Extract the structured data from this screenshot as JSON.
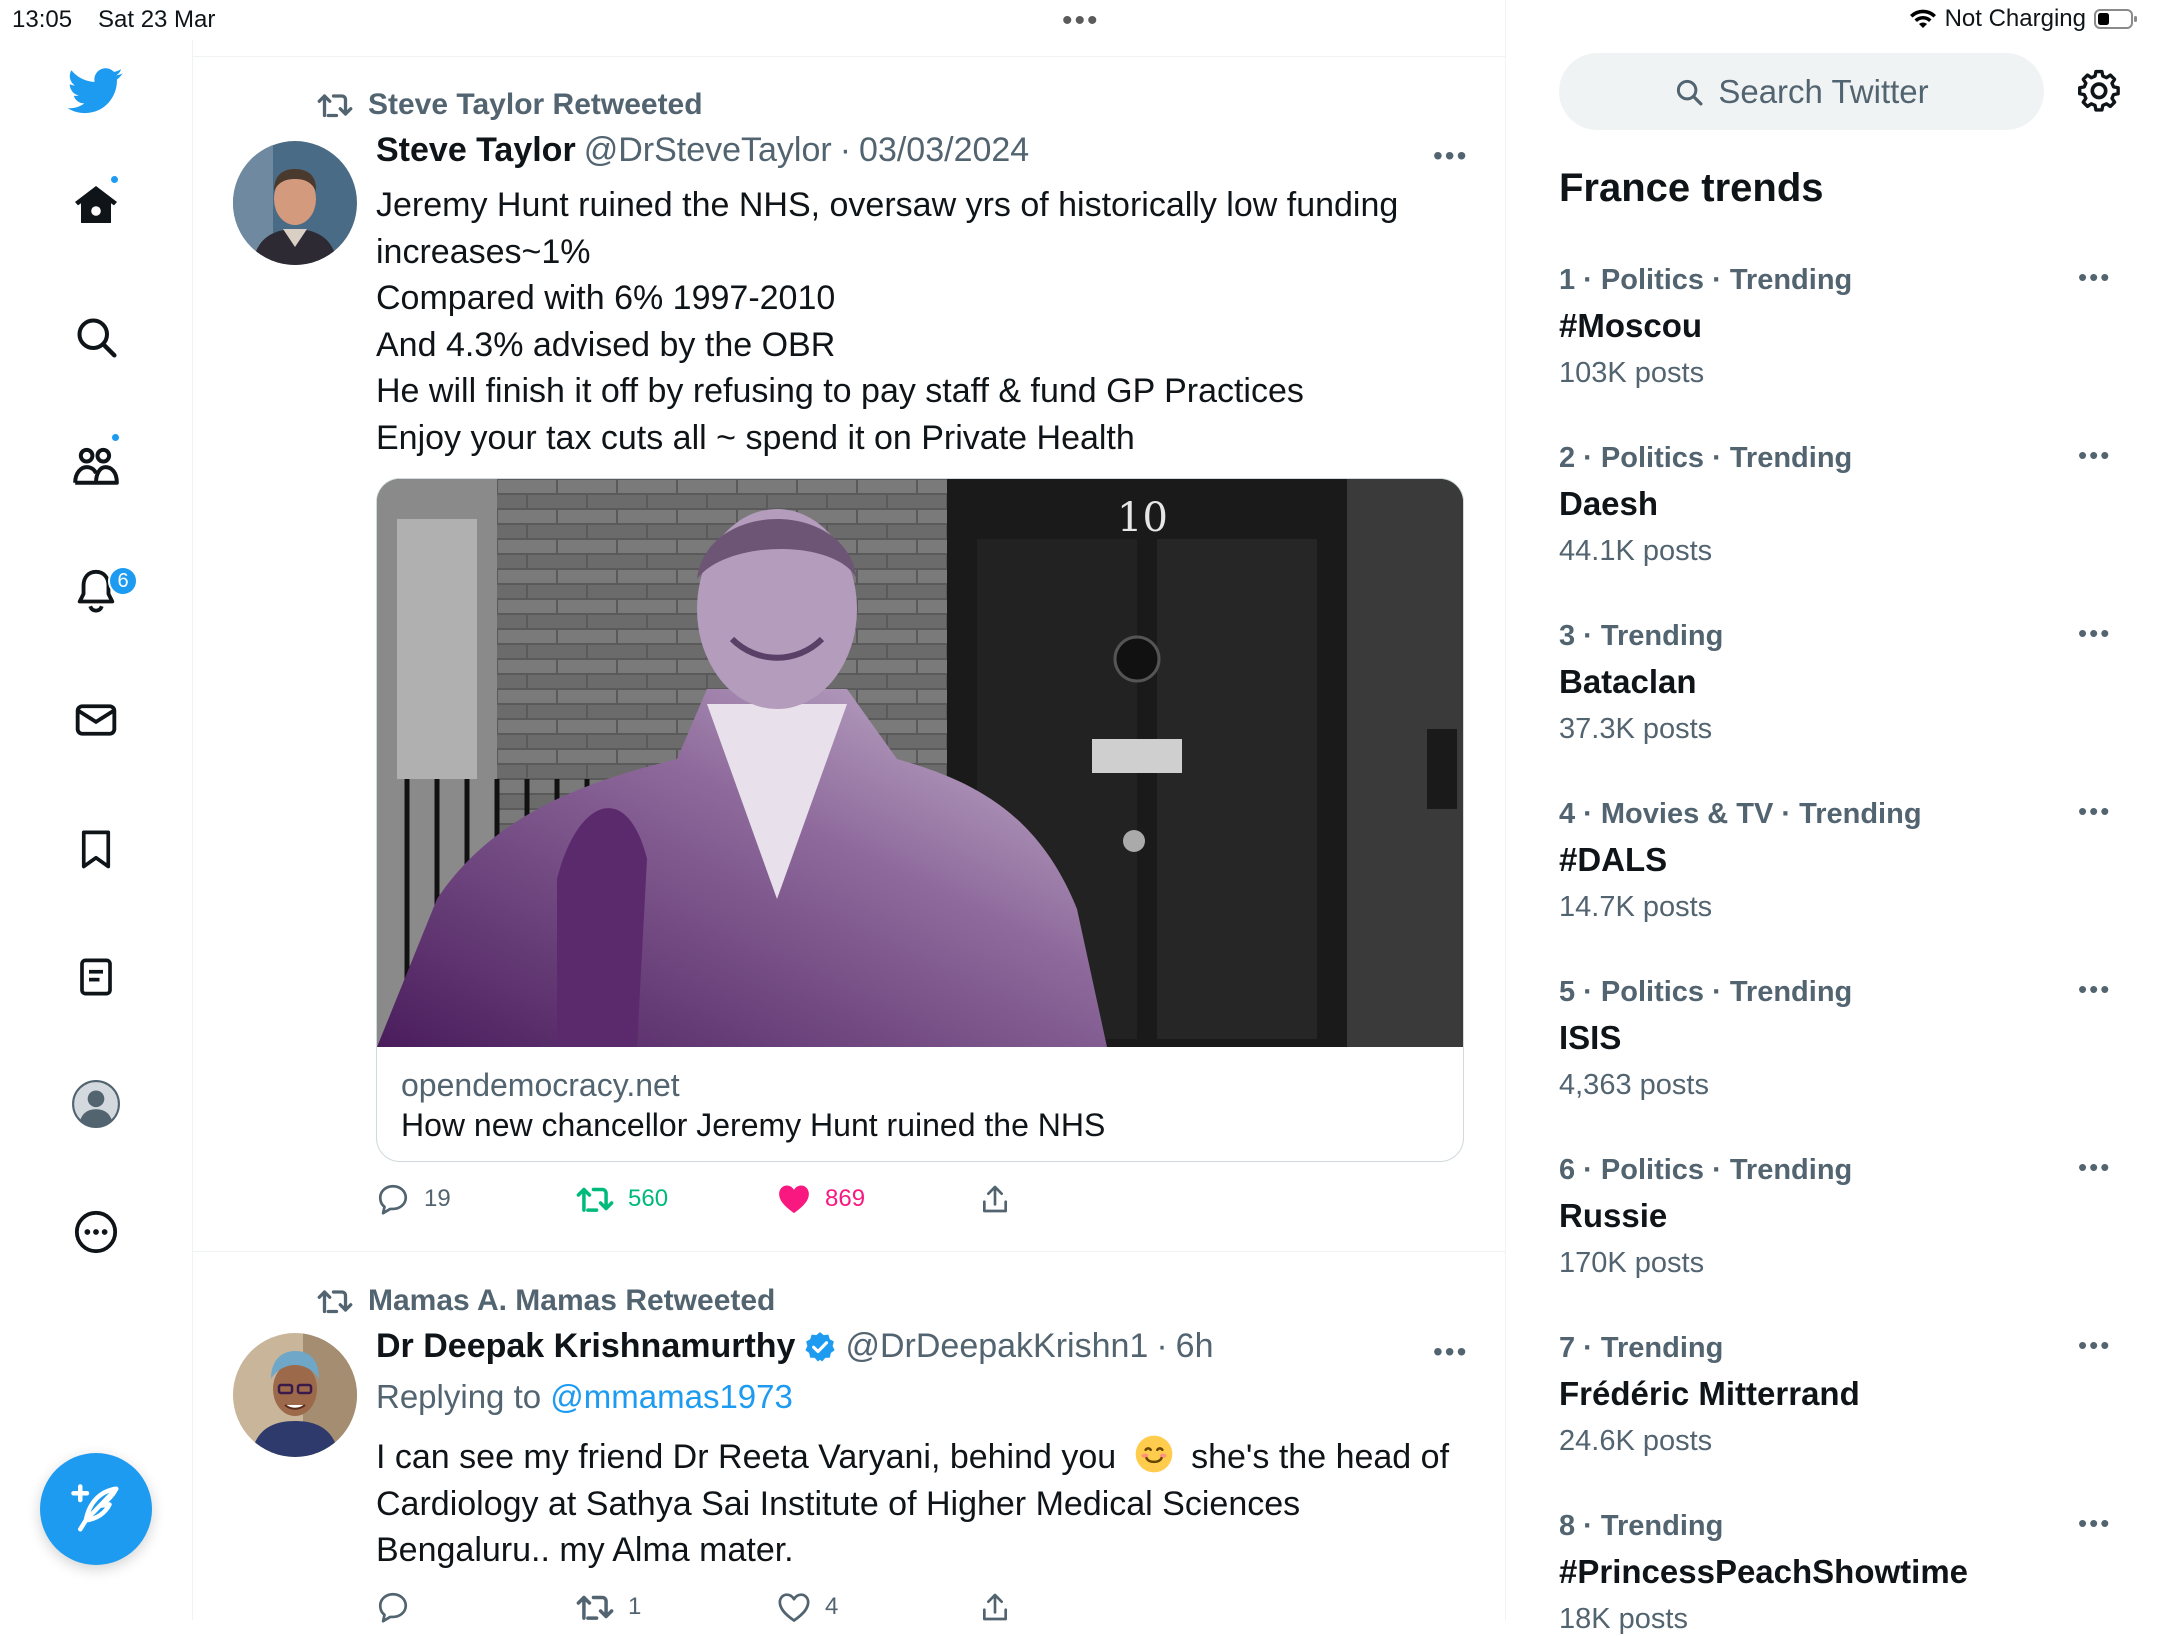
{
  "status_bar": {
    "time": "13:05",
    "date": "Sat 23 Mar",
    "center_dots": "•••",
    "battery_text": "Not Charging"
  },
  "nav": {
    "items": [
      "twitter-logo",
      "home-icon",
      "explore-icon",
      "communities-icon",
      "notifications-icon",
      "messages-icon",
      "bookmarks-icon",
      "lists-icon",
      "profile-icon",
      "more-icon"
    ],
    "notification_count": "6"
  },
  "tweets": [
    {
      "retweeted_by": "Steve Taylor Retweeted",
      "name": "Steve Taylor",
      "handle": "@DrSteveTaylor",
      "sep": "·",
      "time": "03/03/2024",
      "more": "•••",
      "lines": [
        "Jeremy Hunt ruined the NHS, oversaw yrs of historically low funding",
        "increases~1%",
        "Compared with 6% 1997-2010",
        "And 4.3% advised by the OBR",
        "He will finish it off by refusing to pay staff & fund GP Practices",
        "Enjoy your tax cuts all ~ spend it on Private Health"
      ],
      "card": {
        "door_number": "10",
        "domain": "opendemocracy.net",
        "title": "How new chancellor Jeremy Hunt ruined the NHS"
      },
      "replies": "19",
      "retweets": "560",
      "likes": "869"
    },
    {
      "retweeted_by": "Mamas A. Mamas Retweeted",
      "name": "Dr Deepak Krishnamurthy",
      "handle": "@DrDeepakKrishn1",
      "sep": "·",
      "time": "6h",
      "more": "•••",
      "replying_prefix": "Replying to ",
      "replying_to": "@mmamas1973",
      "lines": [
        "I can see my friend Dr Reeta Varyani, behind you",
        "she's the head of",
        "Cardiology at Sathya Sai Institute of Higher Medical Sciences",
        "Bengaluru.. my Alma mater."
      ],
      "replies": "",
      "retweets": "1",
      "likes": "4"
    }
  ],
  "sidebar": {
    "search_placeholder": "Search Twitter",
    "trends_title": "France trends",
    "trends": [
      {
        "meta": "1 · Politics · Trending",
        "name": "#Moscou",
        "posts": "103K posts"
      },
      {
        "meta": "2 · Politics · Trending",
        "name": "Daesh",
        "posts": "44.1K posts"
      },
      {
        "meta": "3 · Trending",
        "name": "Bataclan",
        "posts": "37.3K posts"
      },
      {
        "meta": "4 · Movies & TV · Trending",
        "name": "#DALS",
        "posts": "14.7K posts"
      },
      {
        "meta": "5 · Politics · Trending",
        "name": "ISIS",
        "posts": "4,363 posts"
      },
      {
        "meta": "6 · Politics · Trending",
        "name": "Russie",
        "posts": "170K posts"
      },
      {
        "meta": "7 · Trending",
        "name": "Frédéric Mitterrand",
        "posts": "24.6K posts"
      },
      {
        "meta": "8 · Trending",
        "name": "#PrincessPeachShowtime",
        "posts": "18K posts"
      }
    ],
    "trend_more": "•••"
  },
  "colors": {
    "accent": "#1d9bf0",
    "retweet": "#00ba7c",
    "like": "#f91880",
    "muted": "#536471"
  }
}
